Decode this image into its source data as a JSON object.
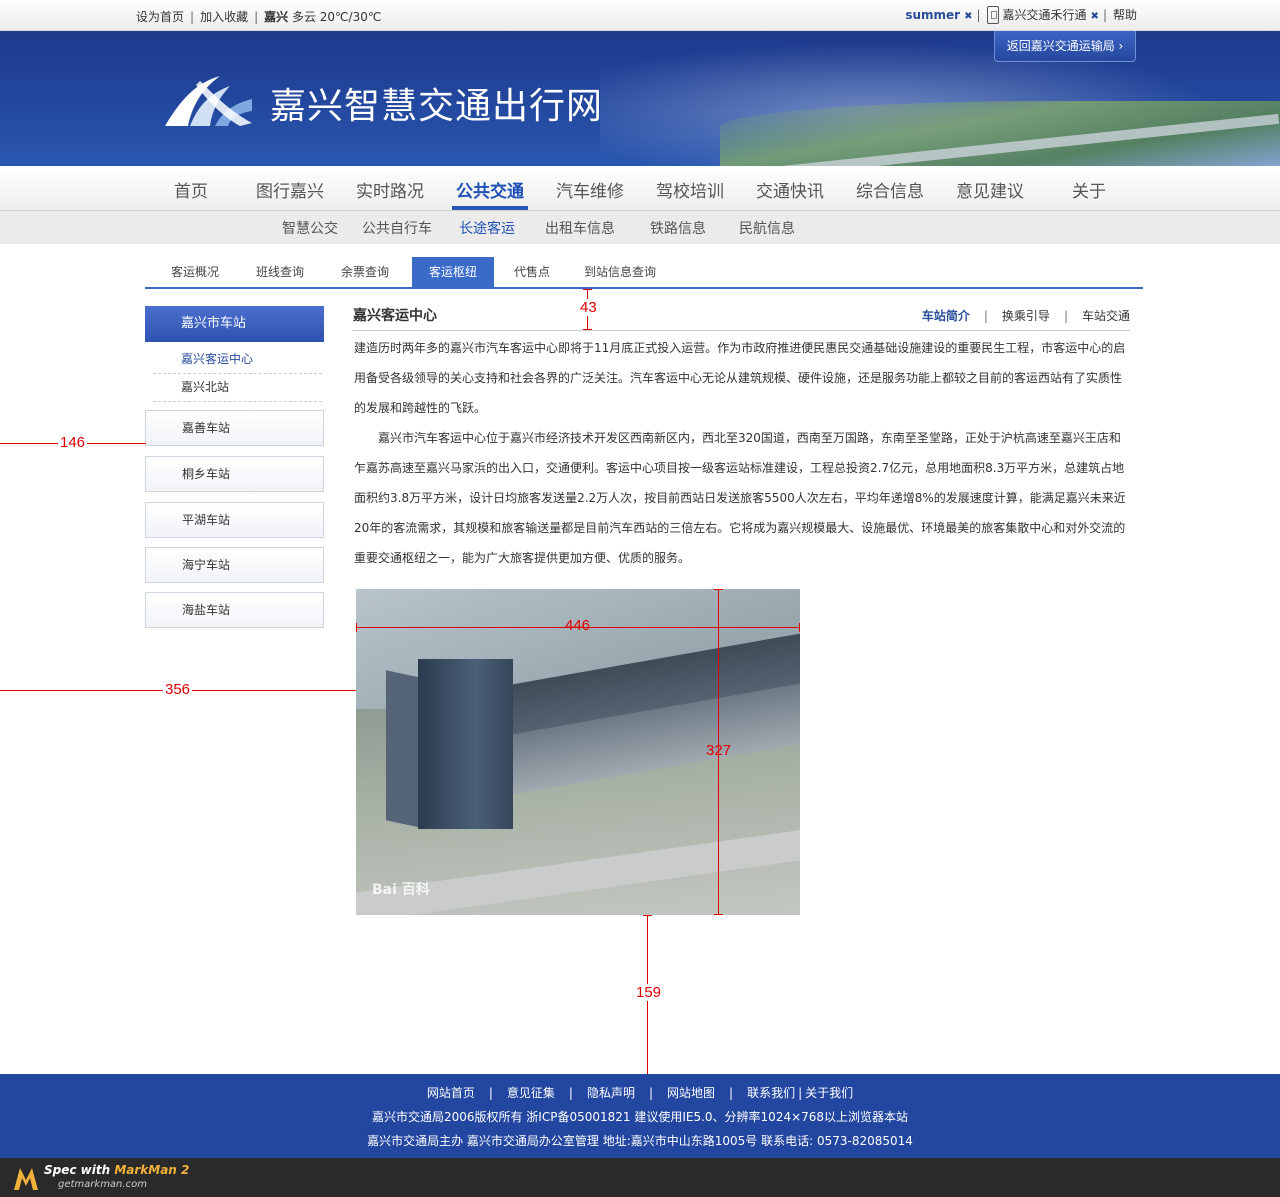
{
  "topbar": {
    "set_home": "设为首页",
    "add_favorite": "加入收藏",
    "city": "嘉兴",
    "weather": "多云 20℃/30℃",
    "user": "summer",
    "app": "嘉兴交通禾行通",
    "help": "帮助"
  },
  "banner": {
    "site_title": "嘉兴智慧交通出行网",
    "back_button": "返回嘉兴交通运输局 ›"
  },
  "main_nav": [
    "首页",
    "图行嘉兴",
    "实时路况",
    "公共交通",
    "汽车维修",
    "驾校培训",
    "交通快讯",
    "综合信息",
    "意见建议",
    "关于"
  ],
  "main_nav_active": "公共交通",
  "sub_nav": [
    "智慧公交",
    "公共自行车",
    "长途客运",
    "出租车信息",
    "铁路信息",
    "民航信息"
  ],
  "sub_nav_active": "长途客运",
  "tabs": [
    "客运概况",
    "班线查询",
    "余票查询",
    "客运枢纽",
    "代售点",
    "到站信息查询"
  ],
  "tabs_active": "客运枢纽",
  "sidebar": {
    "head": "嘉兴市车站",
    "sub_items": [
      "嘉兴客运中心",
      "嘉兴北站"
    ],
    "items": [
      "嘉善车站",
      "桐乡车站",
      "平湖车站",
      "海宁车站",
      "海盐车站"
    ]
  },
  "content": {
    "title": "嘉兴客运中心",
    "links": [
      "车站简介",
      "换乘引导",
      "车站交通"
    ],
    "para1": "建造历时两年多的嘉兴市汽车客运中心即将于11月底正式投入运营。作为市政府推进便民惠民交通基础设施建设的重要民生工程，市客运中心的启用备受各级领导的关心支持和社会各界的广泛关注。汽车客运中心无论从建筑规模、硬件设施，还是服务功能上都较之目前的客运西站有了实质性的发展和跨越性的飞跃。",
    "para2": "嘉兴市汽车客运中心位于嘉兴市经济技术开发区西南新区内，西北至320国道，西南至万国路，东南至圣堂路，正处于沪杭高速至嘉兴王店和乍嘉苏高速至嘉兴马家浜的出入口，交通便利。客运中心项目按一级客运站标准建设，工程总投资2.7亿元，总用地面积8.3万平方米，总建筑占地面积约3.8万平方米，设计日均旅客发送量2.2万人次，按目前西站日发送旅客5500人次左右，平均年递增8%的发展速度计算，能满足嘉兴未来近20年的客流需求，其规模和旅客输送量都是目前汽车西站的三倍左右。它将成为嘉兴规模最大、设施最优、环境最美的旅客集散中心和对外交流的重要交通枢纽之一，能为广大旅客提供更加方便、优质的服务。",
    "photo_watermark": "Bai 百科"
  },
  "footer": {
    "links": [
      "网站首页",
      "意见征集",
      "隐私声明",
      "网站地图",
      "联系我们",
      "关于我们"
    ],
    "line2": "嘉兴市交通局2006版权所有 浙ICP备05001821 建议使用IE5.0、分辨率1024×768以上浏览器本站",
    "line3": "嘉兴市交通局主办 嘉兴市交通局办公室管理   地址:嘉兴市中山东路1005号 联系电话: 0573-82085014"
  },
  "markman": {
    "prefix": "Spec with ",
    "brand": "MarkMan 2",
    "url": "getmarkman.com"
  },
  "annotations": {
    "a43": "43",
    "a146": "146",
    "a446": "446",
    "a356": "356",
    "a327": "327",
    "a159": "159"
  },
  "colors": {
    "brand_blue": "#2346a0",
    "accent_blue": "#3a6bc9",
    "annotation_red": "#e00000"
  }
}
